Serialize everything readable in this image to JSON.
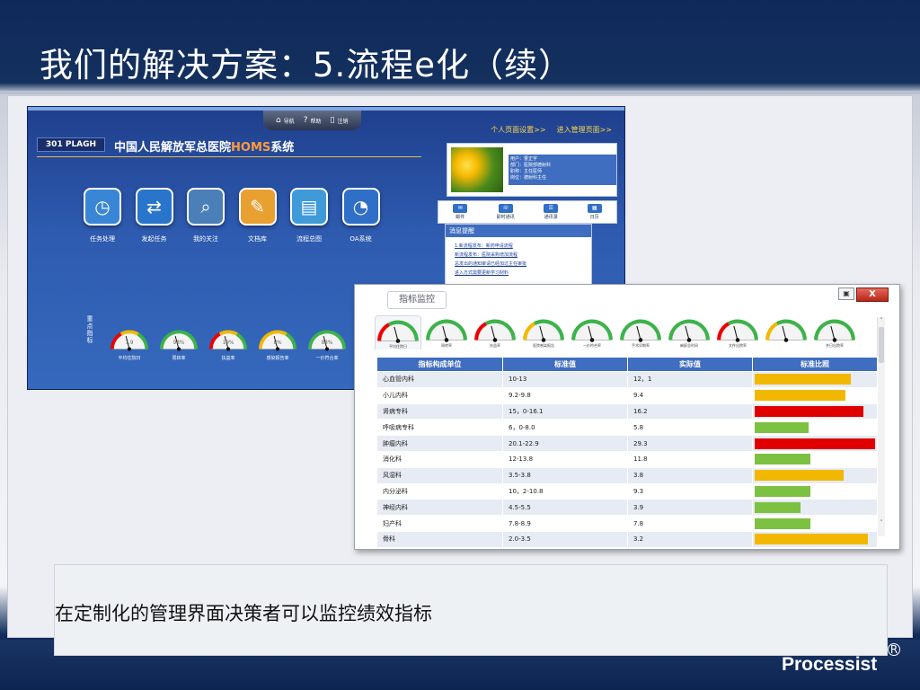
{
  "slide": {
    "title": "我们的解决方案：5.流程e化（续）",
    "caption": "在定制化的管理界面决策者可以监控绩效指标",
    "brand": "Processist",
    "brand_mark": "R"
  },
  "homs": {
    "toolbar": [
      {
        "icon": "home-icon",
        "glyph": "⌂",
        "label": "导航"
      },
      {
        "icon": "help-icon",
        "glyph": "?",
        "label": "帮助"
      },
      {
        "icon": "logout-icon",
        "glyph": "▯",
        "label": "注销"
      }
    ],
    "links": [
      "个人页面设置>>",
      "进入管理页面>>"
    ],
    "logo_text": "301 PLAGH",
    "system_name_prefix": "中国人民解放军总医院",
    "system_name_hl": "HOMS",
    "system_name_suffix": "系统",
    "apps": [
      {
        "label": "任务处理",
        "glyph": "◷",
        "color": "#3a86d6"
      },
      {
        "label": "发起任务",
        "glyph": "⇄",
        "color": "#2a75cc"
      },
      {
        "label": "我的关注",
        "glyph": "⌕",
        "color": "#4a7fb8"
      },
      {
        "label": "文档库",
        "glyph": "✎",
        "color": "#e8a030"
      },
      {
        "label": "流程总图",
        "glyph": "▤",
        "color": "#3f9ad8"
      },
      {
        "label": "OA系统",
        "glyph": "◔",
        "color": "#2f6fc7"
      }
    ],
    "user_info": [
      "用户：曹正宇",
      "部门：医院部德射科",
      "职称：主任医师",
      "岗位：德射科主任"
    ],
    "quick_links": [
      "邮件",
      "即时通讯",
      "通讯录",
      "日历"
    ],
    "notice_title": "消息提醒",
    "notices": [
      "1.新流程发布：新药申请流程",
      "新流程发布：医院采购增加流程",
      "总发出的通知审请已经加过主任审批",
      "进入方式需要更新学习材料"
    ],
    "kpi_side_label": "重点指标",
    "mini_gauges": [
      {
        "label": "平均住院日",
        "value": "7.9"
      },
      {
        "label": "周转率",
        "value": "98%"
      },
      {
        "label": "扶益率",
        "value": "19%"
      },
      {
        "label": "感染报告率",
        "value": "8%"
      },
      {
        "label": "一价符合率",
        "value": "83%"
      }
    ]
  },
  "kpi": {
    "tab": "指标监控",
    "close_label": "X",
    "min_glyph": "▣",
    "gauge_labels": [
      "平均住院日",
      "周转率",
      "扶益率",
      "医院感染报告",
      "一价符合率",
      "手术早期率",
      "麻醉总时间",
      "文件出院率",
      "",
      "并日出院率"
    ],
    "headers": [
      "指标构成单位",
      "标准值",
      "实际值",
      "标准比照"
    ],
    "rows": [
      {
        "unit": "心血管内科",
        "std": "10-13",
        "actual": "12，1",
        "bar": 0.8,
        "color": "#f2b800"
      },
      {
        "unit": "小儿内科",
        "std": "9.2-9.8",
        "actual": "9.4",
        "bar": 0.75,
        "color": "#f2b800"
      },
      {
        "unit": "肾病专科",
        "std": "15，0-16.1",
        "actual": "16.2",
        "bar": 0.9,
        "color": "#e00000"
      },
      {
        "unit": "呼吸病专科",
        "std": "6，0-8.0",
        "actual": "5.8",
        "bar": 0.45,
        "color": "#7cc142"
      },
      {
        "unit": "肿瘤内科",
        "std": "20.1-22.9",
        "actual": "29.3",
        "bar": 1.0,
        "color": "#e00000"
      },
      {
        "unit": "消化科",
        "std": "12-13.8",
        "actual": "11.8",
        "bar": 0.46,
        "color": "#7cc142"
      },
      {
        "unit": "风湿科",
        "std": "3.5-3.8",
        "actual": "3.8",
        "bar": 0.74,
        "color": "#f2b800"
      },
      {
        "unit": "内分泌科",
        "std": "10，2-10.8",
        "actual": "9.3",
        "bar": 0.46,
        "color": "#7cc142"
      },
      {
        "unit": "神经内科",
        "std": "4.5-5.5",
        "actual": "3.9",
        "bar": 0.38,
        "color": "#7cc142"
      },
      {
        "unit": "妇产科",
        "std": "7.8-8.9",
        "actual": "7.8",
        "bar": 0.46,
        "color": "#7cc142"
      },
      {
        "unit": "骨科",
        "std": "2.0-3.5",
        "actual": "3.2",
        "bar": 0.94,
        "color": "#f2b800"
      }
    ]
  }
}
